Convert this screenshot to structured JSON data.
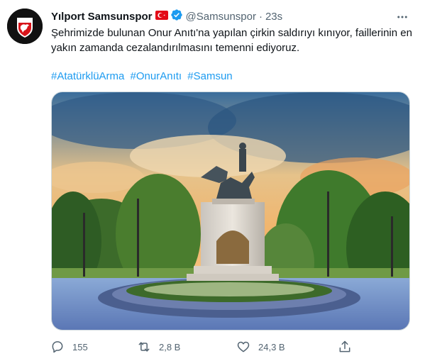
{
  "tweet": {
    "author": {
      "name": "Yılport Samsunspor",
      "handle": "@Samsunspor",
      "verified_icon": "verified-badge-icon",
      "flag_icon": "turkey-flag-icon"
    },
    "separator": "·",
    "time": "23s",
    "text": "Şehrimizde bulunan Onur Anıtı'na yapılan çirkin saldırıyı kınıyor, faillerinin en yakın zamanda cezalandırılmasını temenni ediyoruz.",
    "hashtags": [
      "#AtatürklüArma",
      "#OnurAnıtı",
      "#Samsun"
    ],
    "actions": {
      "reply": {
        "icon": "reply-icon",
        "count": "155"
      },
      "retweet": {
        "icon": "retweet-icon",
        "count": "2,8 B"
      },
      "like": {
        "icon": "heart-icon",
        "count": "24,3 B"
      },
      "share": {
        "icon": "share-icon"
      }
    }
  },
  "colors": {
    "accent": "#1d9bf0",
    "secondary_text": "#536471",
    "primary_text": "#0f1419",
    "border": "#cfd9de",
    "club_red": "#d7141a"
  }
}
